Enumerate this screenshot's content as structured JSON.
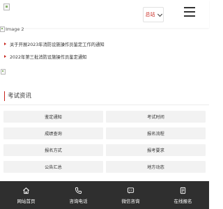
{
  "header": {
    "branch_label": "总站"
  },
  "banner": {
    "alt_text": "Image 2"
  },
  "notices": [
    {
      "title": "关于开展2023年消防设施操作员鉴定工作的通知"
    },
    {
      "title": "2022年第三批消防设施操作员鉴定通知"
    }
  ],
  "section": {
    "title": "考试资讯"
  },
  "grid_buttons": [
    {
      "label": "鉴定通知"
    },
    {
      "label": "考试时间"
    },
    {
      "label": "成绩查询"
    },
    {
      "label": "报名流程"
    },
    {
      "label": "报名方式"
    },
    {
      "label": "报考要求"
    },
    {
      "label": "公告汇总"
    },
    {
      "label": "地方动态"
    }
  ],
  "bottom_nav": [
    {
      "label": "网站首页",
      "icon": "home-icon"
    },
    {
      "label": "咨询电话",
      "icon": "phone-icon"
    },
    {
      "label": "微信咨询",
      "icon": "wechat-icon"
    },
    {
      "label": "在线报名",
      "icon": "form-icon"
    }
  ],
  "colors": {
    "accent": "#c8241c",
    "bottom_bar": "#2f2f2f",
    "grid_bg": "#f2f2f2"
  }
}
